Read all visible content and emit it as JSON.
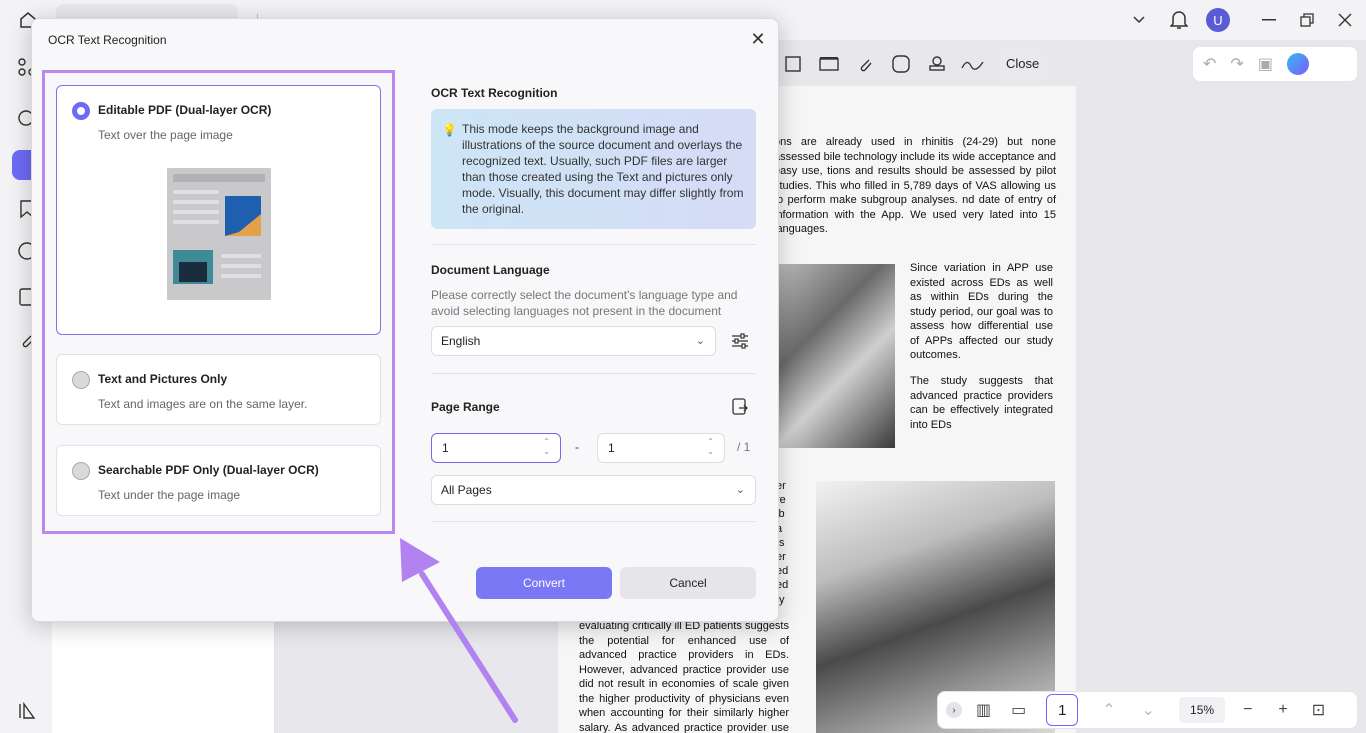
{
  "window": {
    "avatar_letter": "U"
  },
  "toolbar": {
    "close_label": "Close"
  },
  "document": {
    "para1": "ons are already used in rhinitis (24-29) but none assessed bile technology include its wide acceptance and easy use, tions and results should be assessed by pilot studies. This who filled in 5,789 days of VAS allowing us to perform make subgroup analyses. nd date of entry of information with the App. We used very lated into 15 languages.",
    "para2": "Since variation in APP use existed across EDs as well as within EDs during the study period, our goal was to assess how differential use of APPs affected our study outcomes.",
    "para3": "The study suggests that advanced practice providers can be effectively integrated into EDs",
    "col_fragments": "er re ib a ts er ed ed ty",
    "para4": "evaluating critically ill ED patients suggests the potential for enhanced use of advanced practice providers in EDs. However, advanced practice provider use did not result in economies of scale given the higher productivity of physicians even when accounting for their similarly higher salary. As advanced practice provider use in"
  },
  "bottombar": {
    "page": "1",
    "zoom": "15%"
  },
  "dialog": {
    "title": "OCR Text Recognition",
    "options": [
      {
        "title": "Editable PDF (Dual-layer OCR)",
        "subtitle": "Text over the page image",
        "selected": true
      },
      {
        "title": "Text and Pictures Only",
        "subtitle": "Text and images are on the same layer.",
        "selected": false
      },
      {
        "title": "Searchable PDF Only (Dual-layer OCR)",
        "subtitle": "Text under the page image",
        "selected": false
      }
    ],
    "right": {
      "heading": "OCR Text Recognition",
      "info": "This mode keeps the background image and illustrations of the source document and overlays the recognized text. Usually, such PDF files are larger than those created using the Text and pictures only mode. Visually, this document may differ slightly from the original.",
      "language_title": "Document Language",
      "language_desc": "Please correctly select the document's language type and avoid selecting languages not present in the document",
      "language_value": "English",
      "range_title": "Page Range",
      "range_from": "1",
      "range_sep": "-",
      "range_to": "1",
      "range_total": "/ 1",
      "range_mode": "All Pages",
      "convert_label": "Convert",
      "cancel_label": "Cancel"
    }
  },
  "colors": {
    "accent": "#6d6af5",
    "highlight": "#b988f0"
  }
}
